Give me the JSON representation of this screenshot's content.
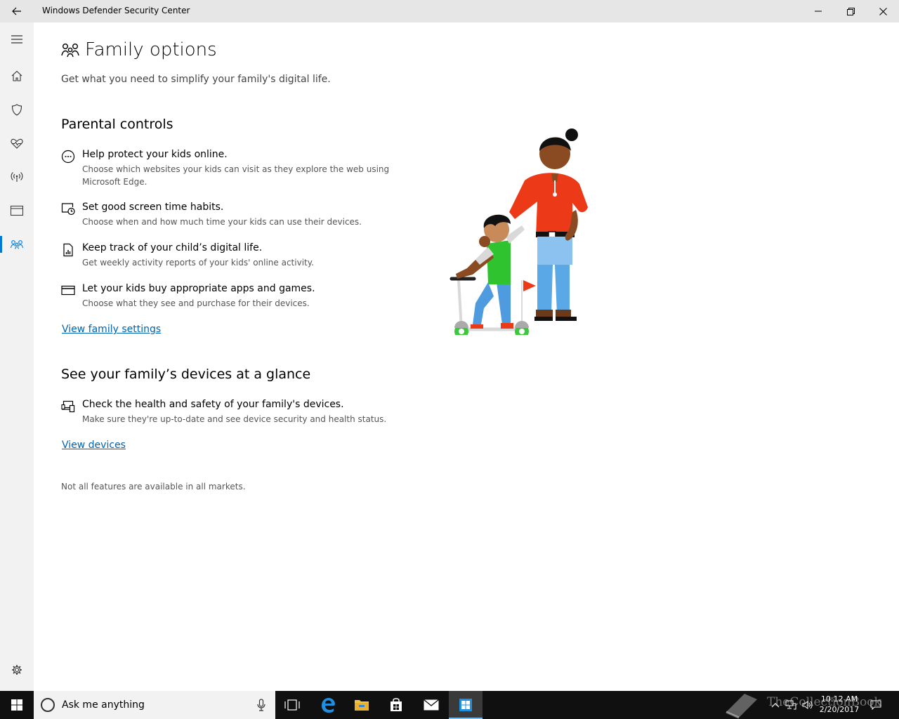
{
  "window": {
    "title": "Windows Defender Security Center"
  },
  "page": {
    "title": "Family options",
    "subtitle": "Get what you need to simplify your family's digital life."
  },
  "parental": {
    "heading": "Parental controls",
    "features": [
      {
        "icon": "web-filter-icon",
        "title": "Help protect your kids online.",
        "desc": "Choose which websites your kids can visit as they explore the web using Microsoft Edge."
      },
      {
        "icon": "screen-time-icon",
        "title": "Set good screen time habits.",
        "desc": "Choose when and how much time your kids can use their devices."
      },
      {
        "icon": "activity-report-icon",
        "title": "Keep track of your child’s digital life.",
        "desc": "Get weekly activity reports of your kids' online activity."
      },
      {
        "icon": "credit-card-icon",
        "title": "Let your kids buy appropriate apps and games.",
        "desc": "Choose what they see and purchase for their devices."
      }
    ],
    "link": "View family settings"
  },
  "devices": {
    "heading": "See your family’s devices at a glance",
    "features": [
      {
        "icon": "devices-icon",
        "title": "Check the health and safety of your family's devices.",
        "desc": "Make sure they're up-to-date and see device security and health status."
      }
    ],
    "link": "View devices"
  },
  "footnote": "Not all features are available in all markets.",
  "taskbar": {
    "search_placeholder": "Ask me anything",
    "time": "10:12 AM",
    "date": "2/20/2017",
    "watermark": "TheCollectionBook"
  },
  "colors": {
    "accent": "#0078d7",
    "link": "#0063b1"
  }
}
